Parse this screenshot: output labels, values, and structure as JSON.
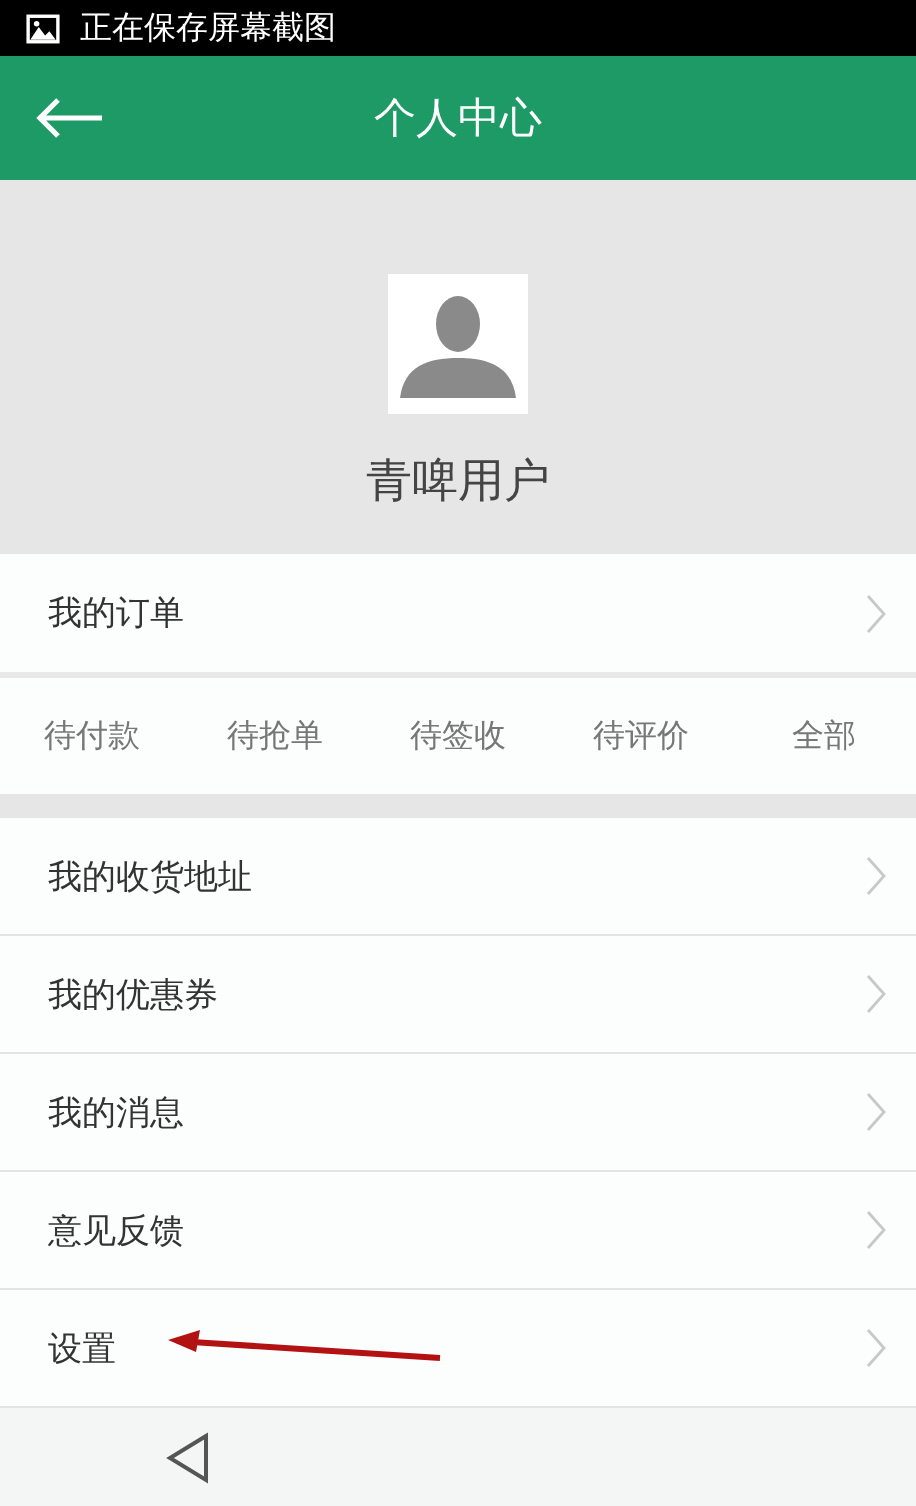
{
  "status_bar": {
    "notification": "正在保存屏幕截图"
  },
  "header": {
    "title": "个人中心"
  },
  "profile": {
    "name": "青啤用户"
  },
  "orders": {
    "label": "我的订单",
    "tabs": [
      {
        "label": "待付款"
      },
      {
        "label": "待抢单"
      },
      {
        "label": "待签收"
      },
      {
        "label": "待评价"
      },
      {
        "label": "全部"
      }
    ]
  },
  "menu": [
    {
      "label": "我的收货地址"
    },
    {
      "label": "我的优惠券"
    },
    {
      "label": "我的消息"
    },
    {
      "label": "意见反馈"
    },
    {
      "label": "设置",
      "annotated": true
    }
  ]
}
